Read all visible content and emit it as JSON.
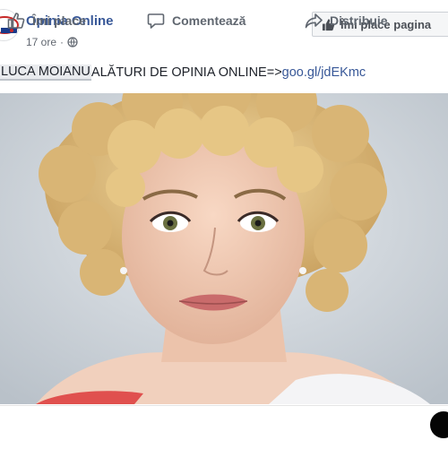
{
  "header": {
    "page_name": "Opinia Online",
    "time": "17 ore",
    "separator": "·",
    "privacy_icon": "globe-icon",
    "like_page_label": "Îmi place pagina",
    "like_page_icon": "thumbs-up-icon"
  },
  "post": {
    "tagged_name": "LUCA MOIANU",
    "text": " ALĂTURI DE OPINIA ONLINE=>",
    "link": "goo.gl/jdEKmc"
  },
  "actions": [
    {
      "label": "Îmi place",
      "icon": "thumbs-up-icon"
    },
    {
      "label": "Comentează",
      "icon": "comment-icon"
    },
    {
      "label": "Distribuie",
      "icon": "share-icon"
    }
  ],
  "colors": {
    "link_blue": "#385898",
    "muted_text": "#606770",
    "button_bg": "#f5f6f7"
  }
}
